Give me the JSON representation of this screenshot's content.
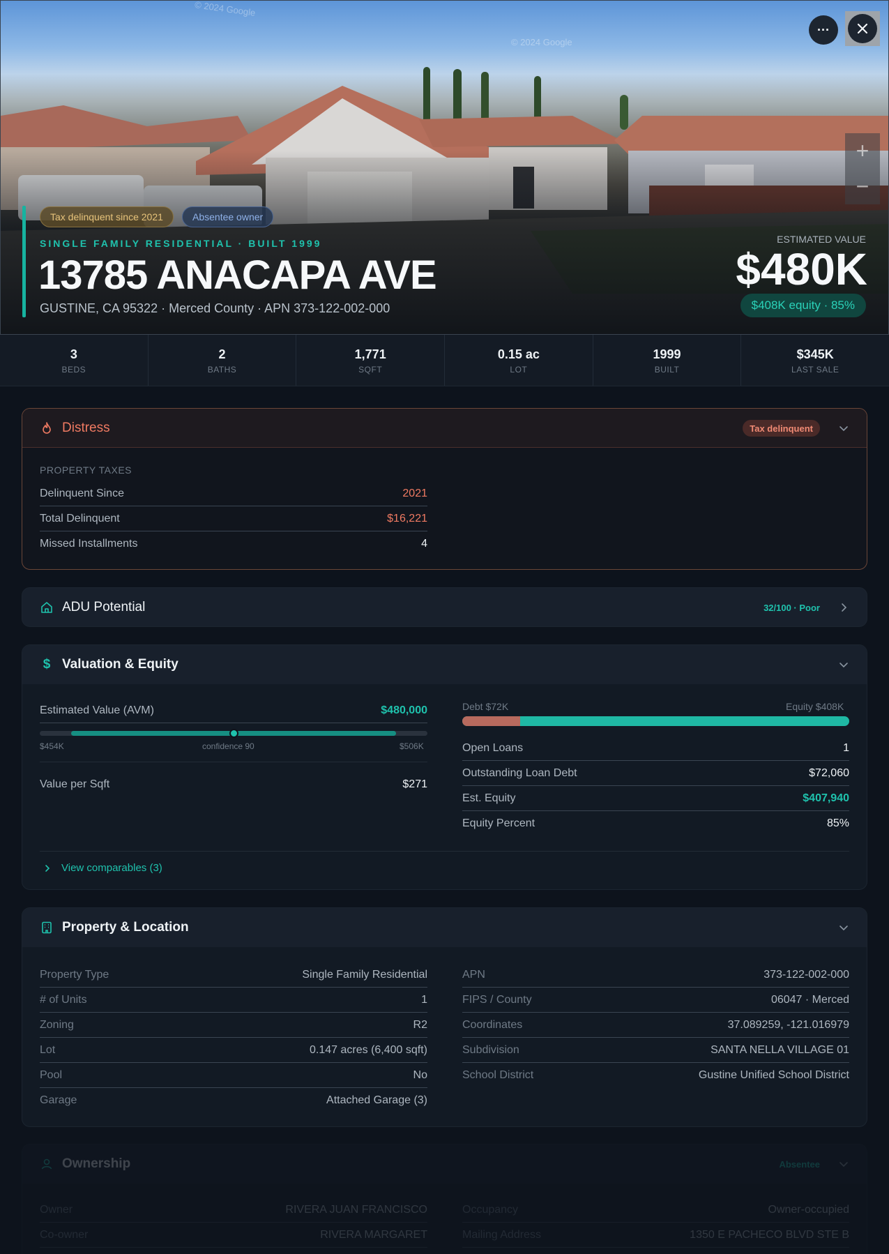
{
  "hero": {
    "watermarks": [
      "© 2024 Google",
      "© 2024 Google"
    ],
    "more_label": "···",
    "zoom_in": "+",
    "zoom_out": "−",
    "tags": [
      "Tax delinquent since 2021",
      "Absentee owner"
    ],
    "subtitle": "SINGLE FAMILY RESIDENTIAL · BUILT 1999",
    "title": "13785 ANACAPA AVE",
    "address": "GUSTINE, CA 95322 · Merced County · APN 373-122-002-000",
    "est_label": "ESTIMATED VALUE",
    "est_value": "$480K",
    "equity": "$408K equity · 85%"
  },
  "stats": [
    {
      "value": "3",
      "label": "BEDS"
    },
    {
      "value": "2",
      "label": "BATHS"
    },
    {
      "value": "1,771",
      "label": "SQFT"
    },
    {
      "value": "0.15 ac",
      "label": "LOT"
    },
    {
      "value": "1999",
      "label": "BUILT"
    },
    {
      "value": "$345K",
      "label": "LAST SALE"
    }
  ],
  "distress": {
    "title": "Distress",
    "badge": "Tax delinquent",
    "section": "PROPERTY TAXES",
    "rows": [
      {
        "k": "Delinquent Since",
        "v": "2021"
      },
      {
        "k": "Total Delinquent",
        "v": "$16,221"
      },
      {
        "k": "Missed Installments",
        "v": "4"
      }
    ]
  },
  "adu": {
    "title": "ADU Potential",
    "score": "32/100 · Poor"
  },
  "valuation": {
    "title": "Valuation & Equity",
    "avm_label": "Estimated Value (AVM)",
    "avm_value": "$480,000",
    "range_low": "$454K",
    "range_high": "$506K",
    "confidence": "confidence 90",
    "avm_position": 0.5,
    "per_sqft_label": "Value per Sqft",
    "per_sqft_value": "$271",
    "debt_label": "Debt $72K",
    "equity_label": "Equity $408K",
    "debt_fraction": 0.15,
    "rows": [
      {
        "k": "Open Loans",
        "v": "1"
      },
      {
        "k": "Outstanding Loan Debt",
        "v": "$72,060"
      },
      {
        "k": "Est. Equity",
        "v": "$407,940"
      },
      {
        "k": "Equity Percent",
        "v": "85%"
      }
    ],
    "comparables_link": "View comparables (3)"
  },
  "property": {
    "title": "Property & Location",
    "left": [
      {
        "k": "Property Type",
        "v": "Single Family Residential"
      },
      {
        "k": "# of Units",
        "v": "1"
      },
      {
        "k": "Zoning",
        "v": "R2"
      },
      {
        "k": "Lot",
        "v": "0.147 acres (6,400 sqft)"
      },
      {
        "k": "Pool",
        "v": "No"
      },
      {
        "k": "Garage",
        "v": "Attached Garage (3)"
      }
    ],
    "right": [
      {
        "k": "APN",
        "v": "373-122-002-000"
      },
      {
        "k": "FIPS / County",
        "v": "06047 · Merced"
      },
      {
        "k": "Coordinates",
        "v": "37.089259, -121.016979"
      },
      {
        "k": "Subdivision",
        "v": "SANTA NELLA VILLAGE 01"
      },
      {
        "k": "School District",
        "v": "Gustine Unified School District"
      }
    ]
  },
  "ownership": {
    "title": "Ownership",
    "badge": "Absentee",
    "left": [
      {
        "k": "Owner",
        "v": "RIVERA JUAN FRANCISCO"
      },
      {
        "k": "Co-owner",
        "v": "RIVERA MARGARET"
      }
    ],
    "right": [
      {
        "k": "Occupancy",
        "v": "Owner-occupied"
      },
      {
        "k": "Mailing Address",
        "v": "1350 E PACHECO BLVD STE B"
      }
    ]
  },
  "colors": {
    "accent": "#1fc2ad",
    "danger": "#ef7a62",
    "tax_chip": "#e6c27a",
    "absentee_chip": "#8fb1e8"
  }
}
